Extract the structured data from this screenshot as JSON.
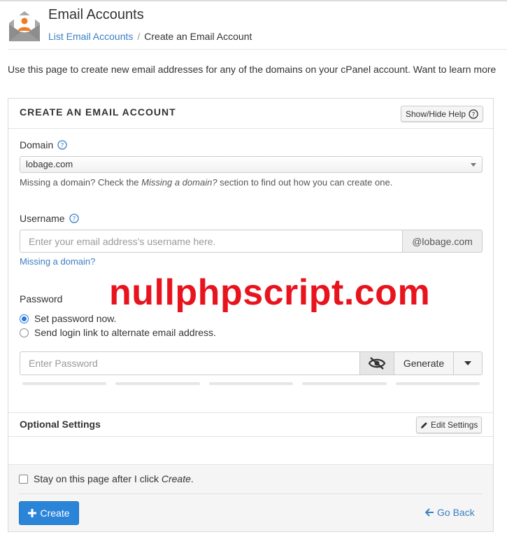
{
  "header": {
    "title": "Email Accounts",
    "breadcrumb_link": "List Email Accounts",
    "breadcrumb_separator": "/",
    "breadcrumb_current": "Create an Email Account"
  },
  "intro_text": "Use this page to create new email addresses for any of the domains on your cPanel account. Want to learn more",
  "panel": {
    "title": "CREATE AN EMAIL ACCOUNT",
    "help_button": "Show/Hide Help"
  },
  "domain": {
    "label": "Domain",
    "selected": "lobage.com",
    "hint_prefix": "Missing a domain? Check the ",
    "hint_emphasis": "Missing a domain?",
    "hint_suffix": " section to find out how you can create one."
  },
  "username": {
    "label": "Username",
    "placeholder": "Enter your email address’s username here.",
    "domain_addon": "@lobage.com",
    "missing_link": "Missing a domain?"
  },
  "watermark": "nullphpscript.com",
  "password": {
    "label": "Password",
    "option_set": "Set password now.",
    "option_send": "Send login link to alternate email address.",
    "placeholder": "Enter Password",
    "generate_label": "Generate"
  },
  "optional": {
    "title": "Optional Settings",
    "edit_button": "Edit Settings"
  },
  "footer": {
    "stay_prefix": "Stay on this page after I click ",
    "stay_emphasis": "Create",
    "stay_suffix": ".",
    "create_label": "Create",
    "back_label": "Go Back"
  },
  "colors": {
    "accent": "#2a85d8",
    "link": "#3b7fc4",
    "watermark": "#e8141d"
  }
}
